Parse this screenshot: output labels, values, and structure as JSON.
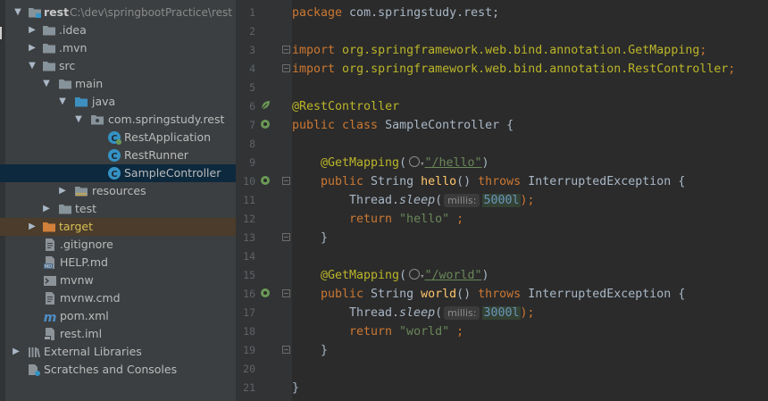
{
  "project_tree": {
    "root": {
      "name": "rest",
      "path": "C:\\dev\\springbootPractice\\rest"
    },
    "items": {
      "idea": ".idea",
      "mvn": ".mvn",
      "src": "src",
      "main": "main",
      "java": "java",
      "pkg": "com.springstudy.rest",
      "rest_application": "RestApplication",
      "rest_runner": "RestRunner",
      "sample_controller": "SampleController",
      "resources": "resources",
      "test": "test",
      "target": "target",
      "gitignore": ".gitignore",
      "help": "HELP.md",
      "mvnw": "mvnw",
      "mvnw_cmd": "mvnw.cmd",
      "pom": "pom.xml",
      "rest_iml": "rest.iml",
      "external_libraries": "External Libraries",
      "scratches": "Scratches and Consoles"
    }
  },
  "editor": {
    "line_numbers": [
      "1",
      "2",
      "3",
      "4",
      "5",
      "6",
      "7",
      "8",
      "9",
      "10",
      "11",
      "12",
      "13",
      "14",
      "15",
      "16",
      "17",
      "18",
      "19",
      "20",
      "21"
    ],
    "code": {
      "l1_kw": "package",
      "l1_rest": " com.springstudy.rest;",
      "l3_kw": "import",
      "l3_pkg": " org.springframework.web.bind.annotation.",
      "l3_cls": "GetMapping",
      "l4_kw": "import",
      "l4_pkg": " org.springframework.web.bind.annotation.",
      "l4_cls": "RestController",
      "semi": ";",
      "l6_ann": "@RestController",
      "l7_kw": "public class",
      "l7_rest": " SampleController {",
      "l9_ann": "@GetMapping",
      "l9_open": "(",
      "l9_url": "\"/hello\"",
      "l9_close": ")",
      "l10_kw1": "public",
      "l10_t": " String ",
      "l10_m": "hello",
      "l10_p": "() ",
      "l10_kw2": "throws",
      "l10_ex": " InterruptedException {",
      "l11_a": "Thread.",
      "l11_m": "sleep",
      "l11_open": "(",
      "l11_hint": "millis:",
      "l11_num": "5000l",
      "l11_end": ");",
      "l12_kw": "return",
      "l12_str": " \"hello\"",
      "l12_end": " ;",
      "brace": "}",
      "l15_ann": "@GetMapping",
      "l15_url": "\"/world\"",
      "l16_m": "world",
      "l17_num": "3000l",
      "l18_str": " \"world\""
    }
  }
}
